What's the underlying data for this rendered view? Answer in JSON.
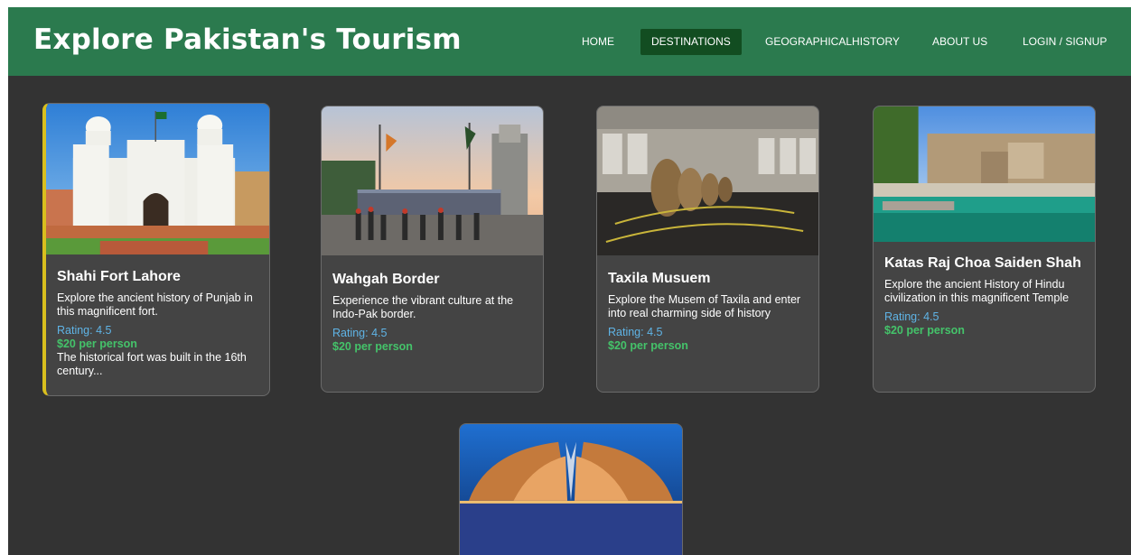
{
  "header": {
    "title": "Explore Pakistan's Tourism",
    "nav": [
      {
        "label": "HOME",
        "active": false
      },
      {
        "label": "DESTINATIONS",
        "active": true
      },
      {
        "label": "GEOGRAPHICALHISTORY",
        "active": false
      },
      {
        "label": "ABOUT US",
        "active": false
      },
      {
        "label": "LOGIN / SIGNUP",
        "active": false
      }
    ]
  },
  "cards": [
    {
      "title": "Shahi Fort Lahore",
      "description": "Explore the ancient history of Punjab in this magnificent fort.",
      "rating": "Rating: 4.5",
      "price": "$20 per person",
      "extra": "The historical fort was built in the 16th century...",
      "image": "shahi-fort-photo"
    },
    {
      "title": "Wahgah Border",
      "description": "Experience the vibrant culture at the Indo-Pak border.",
      "rating": "Rating: 4.5",
      "price": "$20 per person",
      "image": "wagah-border-photo"
    },
    {
      "title": "Taxila Musuem",
      "description": "Explore the Musem of Taxila and enter into real charming side of history",
      "rating": "Rating: 4.5",
      "price": "$20 per person",
      "image": "taxila-museum-photo"
    },
    {
      "title": "Katas Raj Choa Saiden Shah",
      "description": "Explore the ancient History of Hindu civilization in this magnificent Temple",
      "rating": "Rating: 4.5",
      "price": "$20 per person",
      "image": "katas-raj-photo"
    }
  ],
  "bottom_card": {
    "image": "pakistan-monument-photo"
  },
  "colors": {
    "header_bg": "#2b7a4e",
    "nav_active_bg": "#124d21",
    "page_bg": "#333333",
    "card_bg": "#444444",
    "rating": "#5fb4e6",
    "price": "#44c36a",
    "featured_border": "#d9bf1e"
  }
}
